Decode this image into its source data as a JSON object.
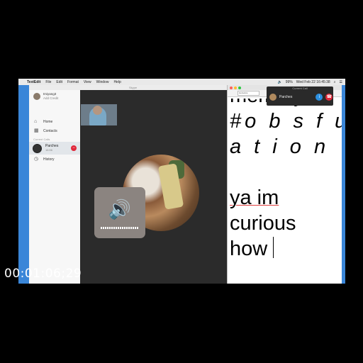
{
  "menubar": {
    "apple": "",
    "app_name": "TextEdit",
    "items": [
      "File",
      "Edit",
      "Format",
      "View",
      "Window",
      "Help"
    ],
    "clock": "Wed Feb 22  16:45:38",
    "battery": "99%"
  },
  "skype": {
    "title": "Skype",
    "profile": {
      "name": "tmiyang3",
      "sub": "Add Credit"
    },
    "nav": [
      {
        "icon": "home-icon",
        "glyph": "⌂",
        "label": "Home"
      },
      {
        "icon": "contacts-icon",
        "glyph": "▦",
        "label": "Contacts"
      }
    ],
    "section_label": "Current Calls",
    "current_call": {
      "name": "Parches",
      "time": "16:56"
    },
    "history_label": "History"
  },
  "call_panel": {
    "title": "Current Call",
    "name": "Parches"
  },
  "textedit": {
    "lines": [
      "memory?",
      "#o b s f u c",
      "a t i o n",
      "",
      "ya im",
      "curious",
      "how"
    ],
    "font_combo": "Helvetica"
  },
  "timecode": "00:01:06;29",
  "colors": {
    "desktop": "#3a86d8",
    "end_call": "#e0283a",
    "info": "#2a8fe0"
  }
}
